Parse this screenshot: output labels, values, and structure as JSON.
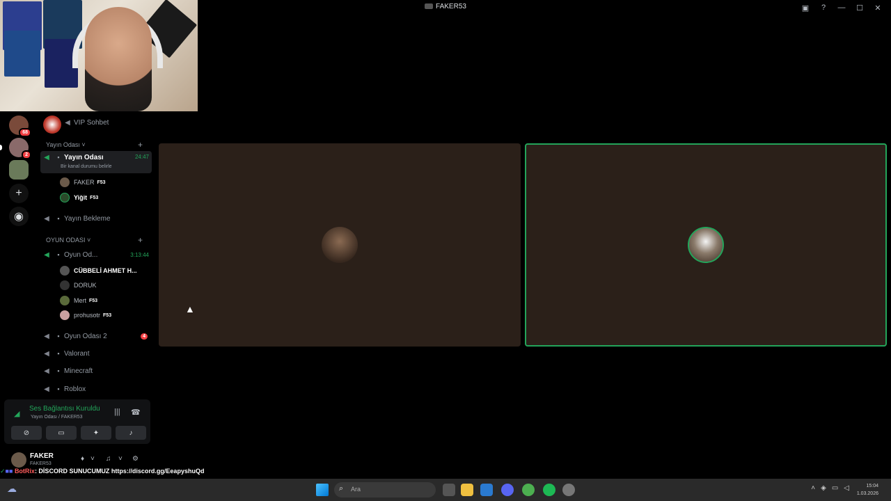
{
  "window": {
    "title": "FAKER53"
  },
  "servers": {
    "badge1": "68",
    "badge2": "2"
  },
  "sidebar": {
    "top_channel": "VIP Sohbet",
    "cat1": "Yayın Odası",
    "active_channel": {
      "name": "Yayın Odası",
      "time": "24:47",
      "status": "Bir kanal durumu belirle"
    },
    "active_users": [
      {
        "name": "FAKER",
        "tag": "F53"
      },
      {
        "name": "Yiğit",
        "tag": "F53"
      }
    ],
    "waiting_channel": "Yayın Bekleme",
    "cat2": "OYUN ODASI",
    "game_channel": {
      "name": "Oyun Od...",
      "time": "3:13:44"
    },
    "game_users": [
      {
        "name": "CÜBBELİ AHMET H..."
      },
      {
        "name": "DORUK"
      },
      {
        "name": "Mert",
        "tag": "F53"
      },
      {
        "name": "prohusotr",
        "tag": "F53"
      }
    ],
    "channels": [
      {
        "name": "Oyun Odası 2",
        "badge": "4"
      },
      {
        "name": "Valorant"
      },
      {
        "name": "Minecraft"
      },
      {
        "name": "Roblox"
      }
    ]
  },
  "voice_panel": {
    "status": "Ses Bağlantısı Kuruldu",
    "location": "Yayın Odası / FAKER53"
  },
  "user_panel": {
    "name": "FAKER",
    "sub": "FAKER53"
  },
  "chat": {
    "sender": "BotRix",
    "message": ": DİSCORD SUNUCUMUZ https://discord.gg/EeapyshuQd"
  },
  "taskbar": {
    "search_placeholder": "Ara",
    "time": "15:04",
    "date": "1.03.2026"
  },
  "colors": {
    "accent_green": "#23a55a",
    "tile_bg": "#2b2019"
  }
}
